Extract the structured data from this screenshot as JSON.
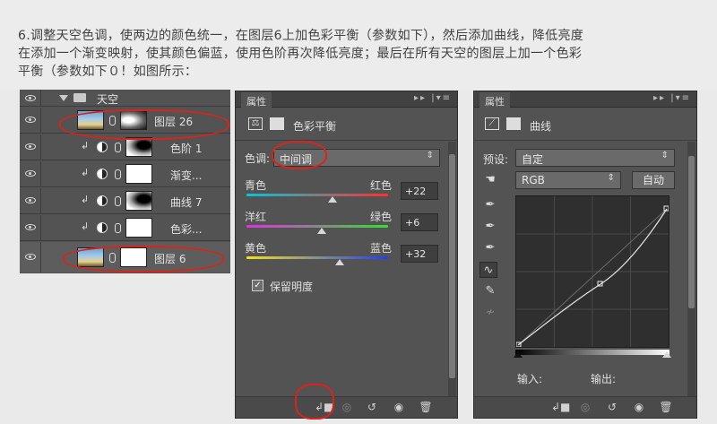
{
  "intro": {
    "line1": "6.调整天空色调，使两边的颜色统一，在图层6上加色彩平衡（参数如下），然后添加曲线，降低亮度",
    "line2": "在添加一个渐变映射，使其颜色偏蓝，使用色阶再次降低亮度；最后在所有天空的图层上加一个色彩",
    "line3": "平衡（参数如下０！如图所示："
  },
  "layers": {
    "group_name": "天空",
    "items": [
      {
        "name": "图层 26"
      },
      {
        "name": "色阶 1"
      },
      {
        "name": "渐变..."
      },
      {
        "name": "曲线 7"
      },
      {
        "name": "色彩..."
      },
      {
        "name": "图层 6"
      }
    ]
  },
  "color_balance_panel": {
    "tab": "属性",
    "title": "色彩平衡",
    "tone_label": "色调:",
    "tone_value": "中间调",
    "sliders": [
      {
        "left": "青色",
        "right": "红色",
        "value": "+22",
        "fraction": 0.61
      },
      {
        "left": "洋红",
        "right": "绿色",
        "value": "+6",
        "fraction": 0.53
      },
      {
        "left": "黄色",
        "right": "蓝色",
        "value": "+32",
        "fraction": 0.66
      }
    ],
    "preserve_label": "保留明度",
    "preserve_checked": true
  },
  "curves_panel": {
    "tab": "属性",
    "title": "曲线",
    "preset_label": "预设:",
    "preset_value": "自定",
    "channel_value": "RGB",
    "auto_label": "自动",
    "input_label": "输入:",
    "output_label": "输出:"
  },
  "icons": {
    "eye": "eye-icon",
    "chain": "link-icon",
    "folder": "folder-icon"
  },
  "colors": {
    "annotation": "#d9241c",
    "panel_bg": "#535353"
  }
}
